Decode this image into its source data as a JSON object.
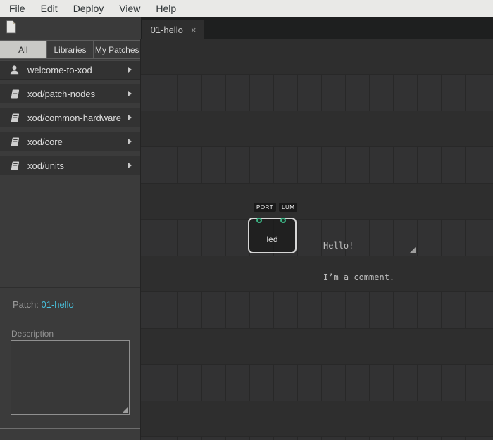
{
  "menu": {
    "items": [
      "File",
      "Edit",
      "Deploy",
      "View",
      "Help"
    ]
  },
  "editor_tabs": {
    "active_label": "01-hello",
    "close_glyph": "×"
  },
  "sidebar": {
    "tabs": [
      {
        "label": "All",
        "active": true
      },
      {
        "label": "Libraries",
        "active": false
      },
      {
        "label": "My Patches",
        "active": false
      }
    ],
    "items": [
      {
        "icon": "user-icon",
        "label": "welcome-to-xod"
      },
      {
        "icon": "book-icon",
        "label": "xod/patch-nodes"
      },
      {
        "icon": "book-icon",
        "label": "xod/common-hardware"
      },
      {
        "icon": "book-icon",
        "label": "xod/core"
      },
      {
        "icon": "book-icon",
        "label": "xod/units"
      }
    ],
    "patch_panel": {
      "label": "Patch:",
      "patch_name": "01-hello",
      "description_label": "Description",
      "description_value": ""
    }
  },
  "canvas": {
    "node": {
      "label": "led",
      "pins": [
        {
          "label": "PORT"
        },
        {
          "label": "LUM"
        }
      ]
    },
    "comment": {
      "line1": "Hello!",
      "line2": "I’m a comment."
    }
  },
  "colors": {
    "accent_cyan": "#48c2de",
    "pin_green": "#3db586",
    "menubar_bg": "#e9e9e7",
    "sidebar_bg": "#3b3b3b",
    "canvas_bg": "#2e2e2e"
  }
}
